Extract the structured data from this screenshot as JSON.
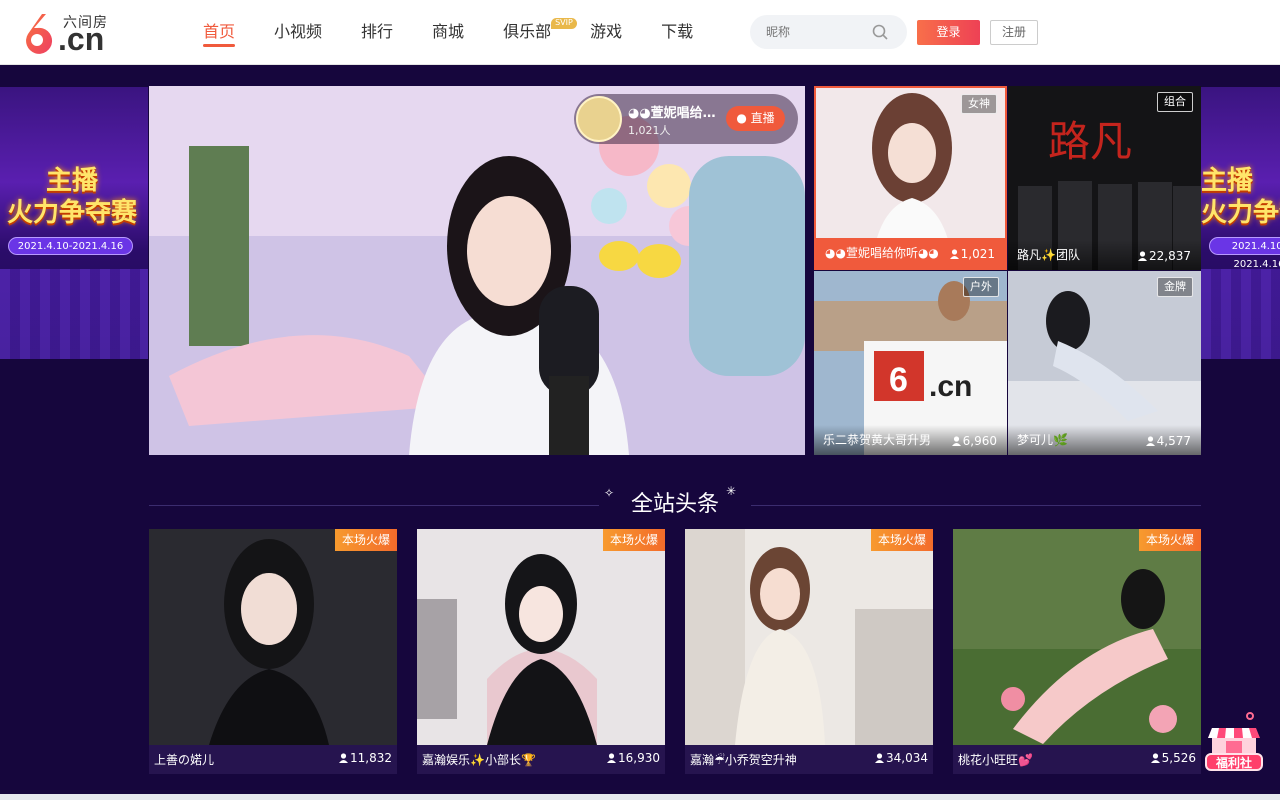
{
  "logo": {
    "top": "六间房",
    "big": ".cn",
    "mark": "6"
  },
  "nav": {
    "items": [
      {
        "label": "首页",
        "active": true
      },
      {
        "label": "小视频",
        "active": false
      },
      {
        "label": "排行",
        "active": false
      },
      {
        "label": "商城",
        "active": false
      },
      {
        "label": "俱乐部",
        "active": false,
        "badge": "SVIP"
      },
      {
        "label": "游戏",
        "active": false
      },
      {
        "label": "下载",
        "active": false
      }
    ]
  },
  "search": {
    "placeholder": "昵称"
  },
  "auth": {
    "login": "登录",
    "register": "注册"
  },
  "banner": {
    "title_line1": "主播",
    "title_line2": "火力争夺赛",
    "date": "2021.4.10-2021.4.16"
  },
  "player": {
    "host_name": "◕◕萱妮唱给…",
    "viewer_count": "1,021人",
    "live_button": "● 直播"
  },
  "grid": [
    {
      "tag": "女神",
      "name": "◕◕萱妮唱给你听◕◕",
      "viewers": "1,021",
      "highlight": true
    },
    {
      "tag": "组合",
      "name": "路凡✨团队",
      "viewers": "22,837",
      "highlight": false
    },
    {
      "tag": "户外",
      "name": "乐二恭贺黄大哥升男",
      "viewers": "6,960",
      "highlight": false
    },
    {
      "tag": "金牌",
      "name": "梦可儿🌿",
      "viewers": "4,577",
      "highlight": false
    }
  ],
  "headlines": {
    "title": "全站头条",
    "cards": [
      {
        "tag": "本场火爆",
        "name": "上善の婼儿",
        "viewers": "11,832"
      },
      {
        "tag": "本场火爆",
        "name": "嘉瀚娱乐✨小部长🏆",
        "viewers": "16,930"
      },
      {
        "tag": "本场火爆",
        "name": "嘉瀚☔小乔贺空升神",
        "viewers": "34,034"
      },
      {
        "tag": "本场火爆",
        "name": "桃花小旺旺💕",
        "viewers": "5,526"
      }
    ]
  },
  "gift": {
    "label": "福利社"
  },
  "colors": {
    "accent": "#f05a3c",
    "page_bg": "#16063d",
    "hot_tag": "#f36b2b"
  }
}
